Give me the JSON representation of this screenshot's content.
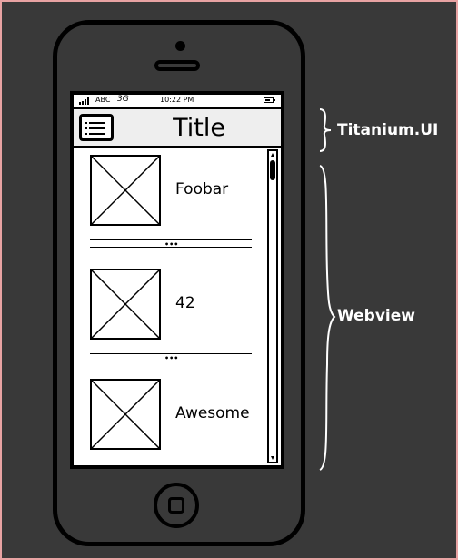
{
  "status_bar": {
    "carrier": "ABC",
    "network": "3G",
    "time": "10:22 PM"
  },
  "nav": {
    "title": "Title",
    "menu_icon": "list-menu-icon"
  },
  "list": {
    "items": [
      {
        "label": "Foobar",
        "image_icon": "image-placeholder-icon"
      },
      {
        "label": "42",
        "image_icon": "image-placeholder-icon"
      },
      {
        "label": "Awesome",
        "image_icon": "image-placeholder-icon"
      }
    ],
    "separator_glyph": "•••"
  },
  "annotations": {
    "titanium": "Titanium.UI",
    "webview": "Webview"
  },
  "colors": {
    "frame_background": "#393939",
    "outer_border": "#e8a3a3",
    "nav_background": "#eeeeee",
    "annotation_text": "#ffffff"
  }
}
